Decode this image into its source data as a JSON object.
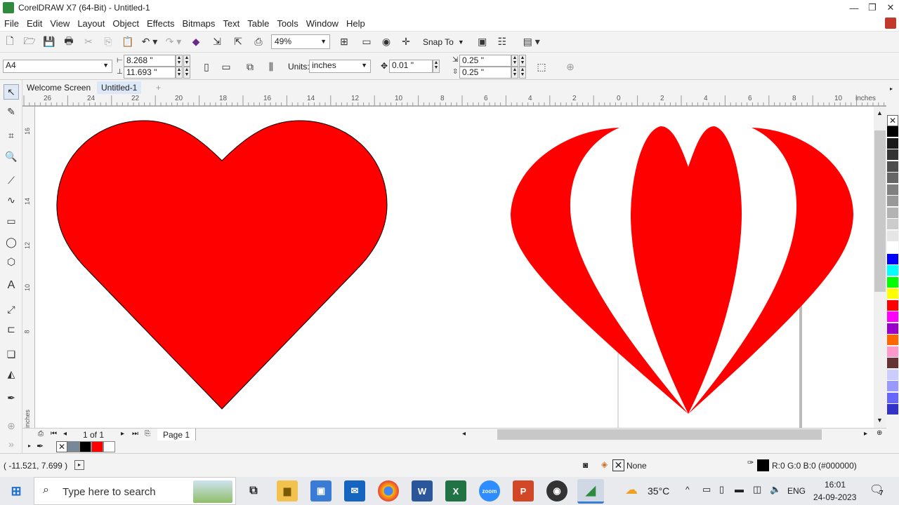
{
  "window": {
    "title": "CorelDRAW X7 (64-Bit) - Untitled-1"
  },
  "menu": [
    "File",
    "Edit",
    "View",
    "Layout",
    "Object",
    "Effects",
    "Bitmaps",
    "Text",
    "Table",
    "Tools",
    "Window",
    "Help"
  ],
  "toolbar": {
    "zoom": "49%",
    "snap_label": "Snap To"
  },
  "property_bar": {
    "page_size": "A4",
    "width": "8.268 \"",
    "height": "11.693 \"",
    "units_label": "Units:",
    "units_value": "inches",
    "nudge": "0.01 \"",
    "dup_x": "0.25 \"",
    "dup_y": "0.25 \""
  },
  "tabs": [
    "Welcome Screen",
    "Untitled-1"
  ],
  "ruler": {
    "h_ticks": [
      "26",
      "24",
      "22",
      "20",
      "18",
      "16",
      "14",
      "12",
      "10",
      "8",
      "6",
      "4",
      "2",
      "0",
      "2",
      "4",
      "6",
      "8",
      "10"
    ],
    "h_unit": "inches",
    "v_ticks": [
      "16",
      "14",
      "12",
      "10",
      "8"
    ],
    "v_unit": "inches"
  },
  "page_nav": {
    "counter": "1 of 1",
    "page_tab": "Page 1"
  },
  "status": {
    "coords": "( -11.521, 7.699 )",
    "fill_label": "None",
    "outline_label": "R:0 G:0 B:0 (#000000)"
  },
  "palette": [
    "#000000",
    "#1a1a1a",
    "#333333",
    "#4d4d4d",
    "#666666",
    "#808080",
    "#999999",
    "#b3b3b3",
    "#cccccc",
    "#e6e6e6",
    "#ffffff",
    "#0000ff",
    "#00ffff",
    "#00ff00",
    "#ffff00",
    "#ff0000",
    "#ff00ff",
    "#9900cc",
    "#ff6600",
    "#ff99cc",
    "#663333",
    "#ccccff",
    "#9999ff",
    "#6666ff",
    "#3333cc"
  ],
  "doc_palette": [
    "#778899",
    "#000000",
    "#ff0000",
    "#ffffff"
  ],
  "taskbar": {
    "search_placeholder": "Type here to search",
    "temperature": "35°C",
    "language": "ENG",
    "time": "16:01",
    "date": "24-09-2023",
    "notifications": "7"
  },
  "colors": {
    "heart": "#ff0000",
    "outline": "#000000"
  }
}
